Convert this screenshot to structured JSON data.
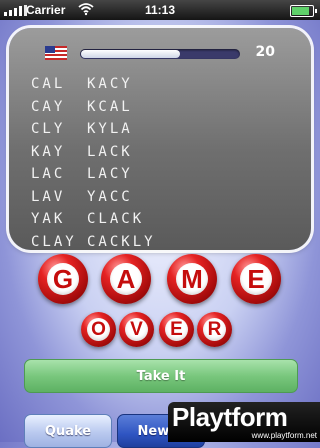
{
  "status_bar": {
    "carrier": "Carrier",
    "time": "11:13",
    "battery_level": 0.85
  },
  "game": {
    "flag_icon": "us-flag-icon",
    "progress": 0.62,
    "word_count": "20",
    "words": [
      [
        "CAL",
        "KACY"
      ],
      [
        "CAY",
        "KCAL"
      ],
      [
        "CLY",
        "KYLA"
      ],
      [
        "KAY",
        "LACK"
      ],
      [
        "LAC",
        "LACY"
      ],
      [
        "LAV",
        "YACC"
      ],
      [
        "YAK",
        "CLACK"
      ],
      [
        "CLAY",
        "CACKLY"
      ]
    ],
    "banner_word_1": [
      "G",
      "A",
      "M",
      "E"
    ],
    "banner_word_2": [
      "O",
      "V",
      "E",
      "R"
    ]
  },
  "buttons": {
    "take_it": "Take It",
    "quake": "Quake",
    "new_game": "New G"
  },
  "watermark": {
    "logo": "Playtform",
    "url": "www.playtform.net"
  },
  "colors": {
    "ball_red": "#e52323",
    "take_green": "#79c77d",
    "new_game_blue": "#2f55c2"
  }
}
